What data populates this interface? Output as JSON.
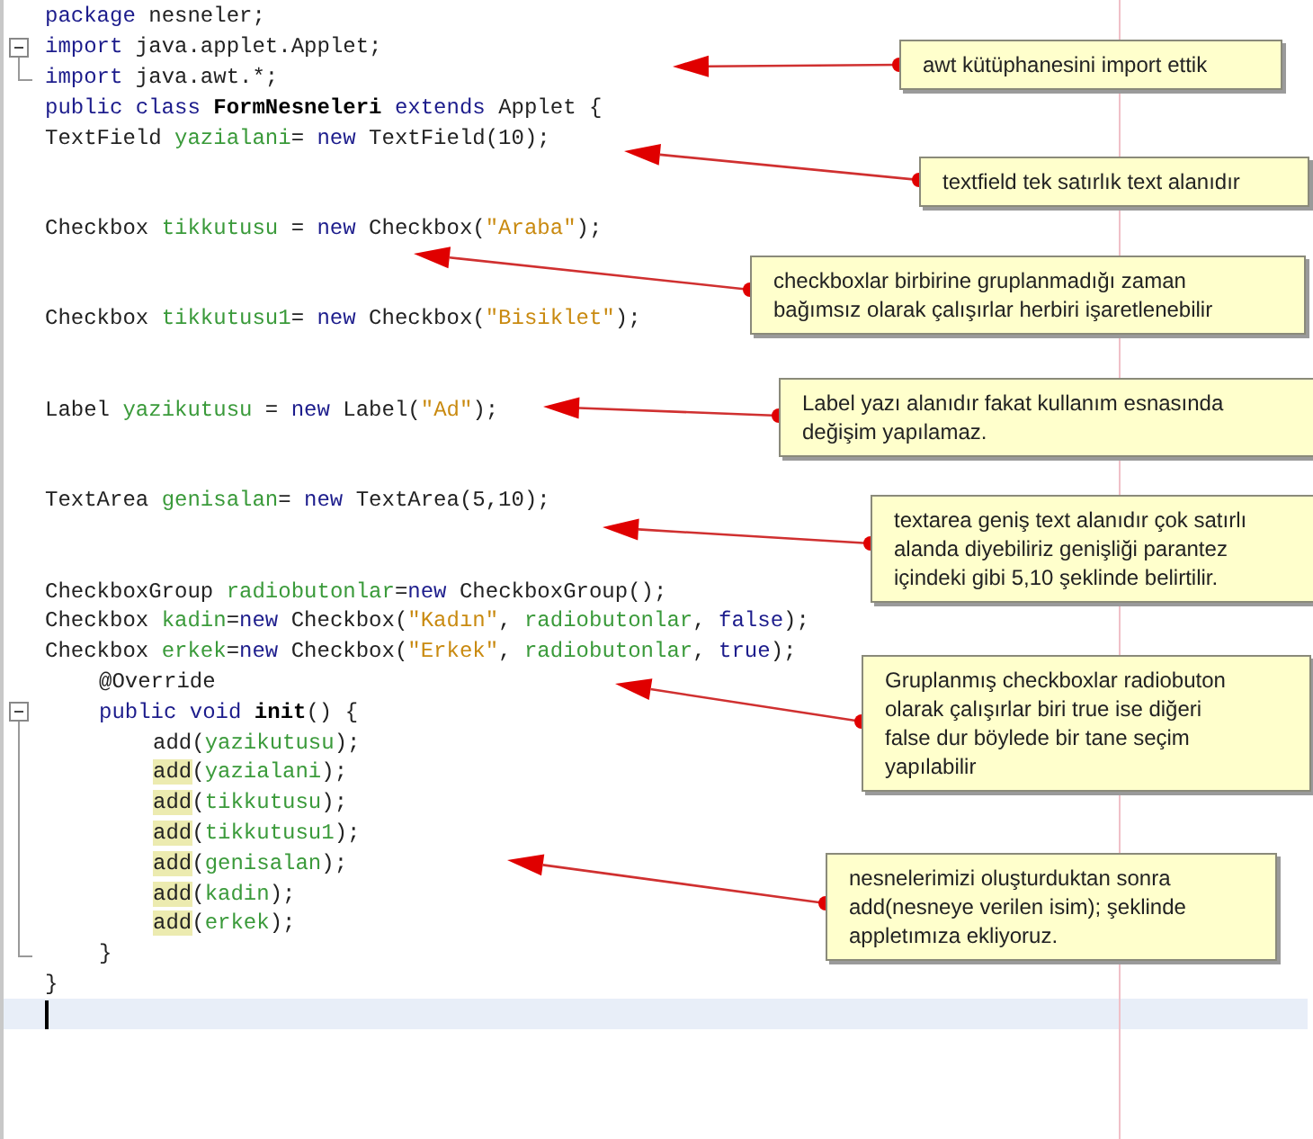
{
  "editor": {
    "lines": [
      {
        "kind": "top",
        "tokens": [
          {
            "kind": "keyword",
            "text": "package"
          },
          {
            "kind": "plain",
            "text": " nesneler;"
          }
        ]
      },
      {
        "kind": "top",
        "gutter": {
          "kind": "start"
        },
        "tokens": [
          {
            "kind": "keyword",
            "text": "import"
          },
          {
            "kind": "plain",
            "text": " java.applet.Applet;"
          }
        ]
      },
      {
        "kind": "top",
        "gutter": {
          "kind": "end"
        },
        "tokens": [
          {
            "kind": "keyword",
            "text": "import"
          },
          {
            "kind": "plain",
            "text": " java.awt.*;"
          }
        ]
      },
      {
        "kind": "top",
        "tokens": [
          {
            "kind": "keyword",
            "text": "public class "
          },
          {
            "kind": "bold",
            "text": "FormNesneleri"
          },
          {
            "kind": "keyword",
            "text": " extends "
          },
          {
            "kind": "plain",
            "text": "Applet {"
          }
        ]
      },
      {
        "kind": "top",
        "tokens": [
          {
            "kind": "plain",
            "text": "TextField "
          },
          {
            "kind": "field",
            "text": "yazialani"
          },
          {
            "kind": "plain",
            "text": "= "
          },
          {
            "kind": "keyword",
            "text": "new"
          },
          {
            "kind": "plain",
            "text": " TextField(10);"
          }
        ]
      },
      {
        "kind": "blank"
      },
      {
        "kind": "blank"
      },
      {
        "kind": "top",
        "tokens": [
          {
            "kind": "plain",
            "text": "Checkbox "
          },
          {
            "kind": "field",
            "text": "tikkutusu"
          },
          {
            "kind": "plain",
            "text": " = "
          },
          {
            "kind": "keyword",
            "text": "new"
          },
          {
            "kind": "plain",
            "text": " Checkbox("
          },
          {
            "kind": "string",
            "text": "\"Araba\""
          },
          {
            "kind": "plain",
            "text": ");"
          }
        ]
      },
      {
        "kind": "blank"
      },
      {
        "kind": "blank"
      },
      {
        "kind": "top",
        "tokens": [
          {
            "kind": "plain",
            "text": "Checkbox "
          },
          {
            "kind": "field",
            "text": "tikkutusu1"
          },
          {
            "kind": "plain",
            "text": "= "
          },
          {
            "kind": "keyword",
            "text": "new"
          },
          {
            "kind": "plain",
            "text": " Checkbox("
          },
          {
            "kind": "string",
            "text": "\"Bisiklet\""
          },
          {
            "kind": "plain",
            "text": ");"
          }
        ]
      },
      {
        "kind": "blank"
      },
      {
        "kind": "blank"
      },
      {
        "kind": "top",
        "tokens": [
          {
            "kind": "plain",
            "text": "Label "
          },
          {
            "kind": "field",
            "text": "yazikutusu"
          },
          {
            "kind": "plain",
            "text": " = "
          },
          {
            "kind": "keyword",
            "text": "new"
          },
          {
            "kind": "plain",
            "text": " Label("
          },
          {
            "kind": "string",
            "text": "\"Ad\""
          },
          {
            "kind": "plain",
            "text": ");"
          }
        ]
      },
      {
        "kind": "blank"
      },
      {
        "kind": "blank"
      },
      {
        "kind": "top",
        "tokens": [
          {
            "kind": "plain",
            "text": "TextArea "
          },
          {
            "kind": "field",
            "text": "genisalan"
          },
          {
            "kind": "plain",
            "text": "= "
          },
          {
            "kind": "keyword",
            "text": "new"
          },
          {
            "kind": "plain",
            "text": " TextArea(5,10);"
          }
        ]
      },
      {
        "kind": "blank"
      },
      {
        "kind": "blank"
      },
      {
        "kind": "top",
        "tokens": [
          {
            "kind": "plain",
            "text": "CheckboxGroup "
          },
          {
            "kind": "field",
            "text": "radiobutonlar"
          },
          {
            "kind": "plain",
            "text": "="
          },
          {
            "kind": "keyword",
            "text": "new"
          },
          {
            "kind": "plain",
            "text": " CheckboxGroup();"
          }
        ]
      },
      {
        "kind": "top",
        "tokens": [
          {
            "kind": "plain",
            "text": "Checkbox "
          },
          {
            "kind": "field",
            "text": "kadin"
          },
          {
            "kind": "plain",
            "text": "="
          },
          {
            "kind": "keyword",
            "text": "new"
          },
          {
            "kind": "plain",
            "text": " Checkbox("
          },
          {
            "kind": "string",
            "text": "\"Kadın\""
          },
          {
            "kind": "plain",
            "text": ", "
          },
          {
            "kind": "field",
            "text": "radiobutonlar"
          },
          {
            "kind": "plain",
            "text": ", "
          },
          {
            "kind": "keyword",
            "text": "false"
          },
          {
            "kind": "plain",
            "text": ");"
          }
        ]
      },
      {
        "kind": "top",
        "tokens": [
          {
            "kind": "plain",
            "text": "Checkbox "
          },
          {
            "kind": "field",
            "text": "erkek"
          },
          {
            "kind": "plain",
            "text": "="
          },
          {
            "kind": "keyword",
            "text": "new"
          },
          {
            "kind": "plain",
            "text": " Checkbox("
          },
          {
            "kind": "string",
            "text": "\"Erkek\""
          },
          {
            "kind": "plain",
            "text": ", "
          },
          {
            "kind": "field",
            "text": "radiobutonlar"
          },
          {
            "kind": "plain",
            "text": ", "
          },
          {
            "kind": "keyword",
            "text": "true"
          },
          {
            "kind": "plain",
            "text": ");"
          }
        ]
      },
      {
        "kind": "method",
        "tokens": [
          {
            "kind": "plain",
            "text": "@Override"
          }
        ]
      },
      {
        "kind": "method",
        "gutter": {
          "kind": "start"
        },
        "tokens": [
          {
            "kind": "keyword",
            "text": "public void "
          },
          {
            "kind": "bold",
            "text": "init"
          },
          {
            "kind": "plain",
            "text": "() {"
          }
        ]
      },
      {
        "kind": "body",
        "tokens": [
          {
            "kind": "plain",
            "text": "add",
            "highlighted": false
          },
          {
            "kind": "plain",
            "text": "(",
            "highlighted": false
          },
          {
            "kind": "field",
            "text": "yazikutusu",
            "highlighted": false
          },
          {
            "kind": "plain",
            "text": ");",
            "highlighted": false
          }
        ]
      },
      {
        "kind": "body",
        "tokens": [
          {
            "kind": "plain",
            "text": "add",
            "highlighted": true
          },
          {
            "kind": "plain",
            "text": "(",
            "highlighted": false
          },
          {
            "kind": "field",
            "text": "yazialani",
            "highlighted": false
          },
          {
            "kind": "plain",
            "text": ");",
            "highlighted": false
          }
        ]
      },
      {
        "kind": "body",
        "tokens": [
          {
            "kind": "plain",
            "text": "add",
            "highlighted": true
          },
          {
            "kind": "plain",
            "text": "(",
            "highlighted": false
          },
          {
            "kind": "field",
            "text": "tikkutusu",
            "highlighted": false
          },
          {
            "kind": "plain",
            "text": ");",
            "highlighted": false
          }
        ]
      },
      {
        "kind": "body",
        "tokens": [
          {
            "kind": "plain",
            "text": "add",
            "highlighted": true
          },
          {
            "kind": "plain",
            "text": "(",
            "highlighted": false
          },
          {
            "kind": "field",
            "text": "tikkutusu1",
            "highlighted": false
          },
          {
            "kind": "plain",
            "text": ");",
            "highlighted": false
          }
        ]
      },
      {
        "kind": "body",
        "tokens": [
          {
            "kind": "plain",
            "text": "add",
            "highlighted": true
          },
          {
            "kind": "plain",
            "text": "(",
            "highlighted": false
          },
          {
            "kind": "field",
            "text": "genisalan",
            "highlighted": false
          },
          {
            "kind": "plain",
            "text": ");",
            "highlighted": false
          }
        ]
      },
      {
        "kind": "body",
        "tokens": [
          {
            "kind": "plain",
            "text": "add",
            "highlighted": true
          },
          {
            "kind": "plain",
            "text": "(",
            "highlighted": false
          },
          {
            "kind": "field",
            "text": "kadin",
            "highlighted": false
          },
          {
            "kind": "plain",
            "text": ");",
            "highlighted": false
          }
        ]
      },
      {
        "kind": "body",
        "tokens": [
          {
            "kind": "plain",
            "text": "add",
            "highlighted": true
          },
          {
            "kind": "plain",
            "text": "(",
            "highlighted": false
          },
          {
            "kind": "field",
            "text": "erkek",
            "highlighted": false
          },
          {
            "kind": "plain",
            "text": ");",
            "highlighted": false
          }
        ]
      },
      {
        "kind": "method",
        "gutter": {
          "kind": "end"
        },
        "tokens": [
          {
            "kind": "plain",
            "text": "}"
          }
        ]
      },
      {
        "kind": "top",
        "tokens": [
          {
            "kind": "plain",
            "text": "}"
          }
        ]
      },
      {
        "kind": "current"
      }
    ]
  },
  "callouts": [
    {
      "lines": [
        "awt kütüphanesini import ettik"
      ]
    },
    {
      "lines": [
        "textfield tek satırlık text alanıdır"
      ]
    },
    {
      "lines": [
        "checkboxlar birbirine gruplanmadığı zaman",
        "bağımsız olarak çalışırlar herbiri işaretlenebilir"
      ]
    },
    {
      "lines": [
        "Label yazı alanıdır fakat kullanım esnasında",
        "değişim yapılamaz."
      ]
    },
    {
      "lines": [
        "textarea geniş text alanıdır çok satırlı",
        "alanda diyebiliriz genişliği parantez",
        "içindeki gibi 5,10 şeklinde belirtilir."
      ]
    },
    {
      "lines": [
        "Gruplanmış checkboxlar radiobuton",
        "olarak çalışırlar biri true ise diğeri",
        "false dur böylede bir tane seçim",
        "yapılabilir"
      ]
    },
    {
      "lines": [
        "nesnelerimizi oluşturduktan sonra",
        "add(nesneye verilen isim); şeklinde",
        "appletımıza ekliyoruz."
      ]
    }
  ]
}
